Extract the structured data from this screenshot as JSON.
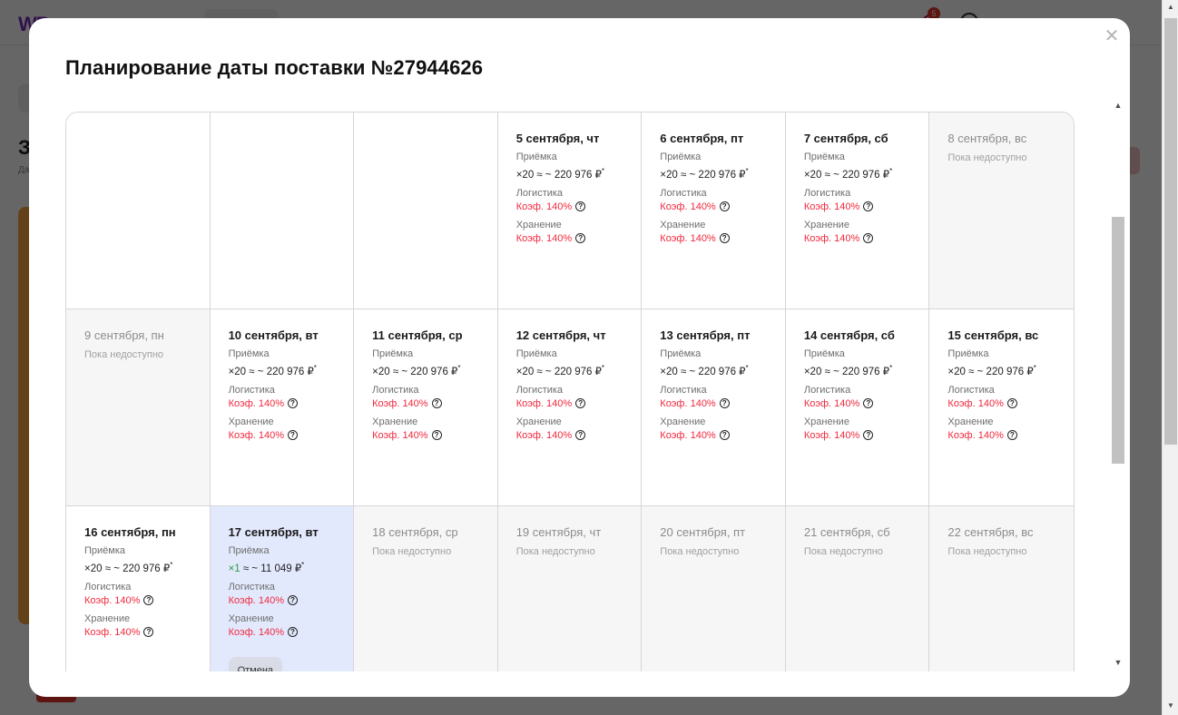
{
  "modal": {
    "title": "Планирование даты поставки №27944626",
    "close_icon": "close-icon"
  },
  "labels": {
    "acceptance": "Приёмка",
    "logistics": "Логистика",
    "storage": "Хранение",
    "coef": "Коэф. 140%",
    "unavailable": "Пока недоступно",
    "cancel": "Отмена",
    "help_icon": "question-circle-icon"
  },
  "colors": {
    "coef_red": "#f0283c",
    "selected_bg": "#e3e9fd",
    "unavailable_bg": "#f6f6f7",
    "multiplier_green": "#2e9b44"
  },
  "calendar": {
    "weeks": [
      [
        {
          "blank": true
        },
        {
          "blank": true
        },
        {
          "blank": true
        },
        {
          "date": "5 сентября, чт",
          "status": "available",
          "multiplier": "×20",
          "amount": "≈ ~ 220 976 ₽",
          "sup": "*"
        },
        {
          "date": "6 сентября, пт",
          "status": "available",
          "multiplier": "×20",
          "amount": "≈ ~ 220 976 ₽",
          "sup": "*"
        },
        {
          "date": "7 сентября, сб",
          "status": "available",
          "multiplier": "×20",
          "amount": "≈ ~ 220 976 ₽",
          "sup": "*"
        },
        {
          "date": "8 сентября, вс",
          "status": "unavailable"
        }
      ],
      [
        {
          "date": "9 сентября, пн",
          "status": "unavailable"
        },
        {
          "date": "10 сентября, вт",
          "status": "available",
          "multiplier": "×20",
          "amount": "≈ ~ 220 976 ₽",
          "sup": "*"
        },
        {
          "date": "11 сентября, ср",
          "status": "available",
          "multiplier": "×20",
          "amount": "≈ ~ 220 976 ₽",
          "sup": "*"
        },
        {
          "date": "12 сентября, чт",
          "status": "available",
          "multiplier": "×20",
          "amount": "≈ ~ 220 976 ₽",
          "sup": "*"
        },
        {
          "date": "13 сентября, пт",
          "status": "available",
          "multiplier": "×20",
          "amount": "≈ ~ 220 976 ₽",
          "sup": "*"
        },
        {
          "date": "14 сентября, сб",
          "status": "available",
          "multiplier": "×20",
          "amount": "≈ ~ 220 976 ₽",
          "sup": "*"
        },
        {
          "date": "15 сентября, вс",
          "status": "available",
          "multiplier": "×20",
          "amount": "≈ ~ 220 976 ₽",
          "sup": "*"
        }
      ],
      [
        {
          "date": "16 сентября, пн",
          "status": "available",
          "multiplier": "×20",
          "amount": "≈ ~ 220 976 ₽",
          "sup": "*"
        },
        {
          "date": "17 сентября, вт",
          "status": "selected",
          "multiplier": "×1",
          "amount": "≈ ~ 11 049 ₽",
          "sup": "*"
        },
        {
          "date": "18 сентября, ср",
          "status": "unavailable"
        },
        {
          "date": "19 сентября, чт",
          "status": "unavailable"
        },
        {
          "date": "20 сентября, пт",
          "status": "unavailable"
        },
        {
          "date": "21 сентября, сб",
          "status": "unavailable"
        },
        {
          "date": "22 сентября, вс",
          "status": "unavailable"
        }
      ]
    ]
  }
}
